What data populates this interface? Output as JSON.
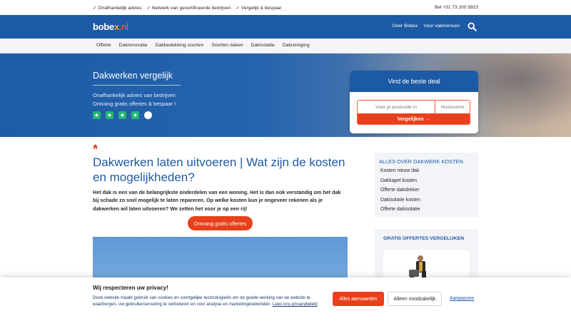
{
  "topbar": {
    "usps": [
      "Onafhankelijk advies",
      "Netwerk van gecertificeerde bedrijven",
      "Vergelijk & bespaar"
    ],
    "phone": "Bel +31 73 200 5923"
  },
  "header": {
    "logo_main": "bobe",
    "logo_x": "x",
    "logo_nl": ".nl",
    "nav": [
      "Over Bobex",
      "Voor vakmensen"
    ]
  },
  "subnav": [
    "Offerte",
    "Dakrenovatie",
    "Dakbedekking soorten",
    "Soorten daken",
    "Dakisolatie",
    "Dakreiniging"
  ],
  "hero": {
    "title": "Dakwerken vergelijk",
    "line1": "Onafhankelijk advies van bedrijven",
    "line2": "Ontvang gratis offertes & bespaar !",
    "rating": {
      "filled": 4,
      "total": 5
    },
    "deal_title": "Vind de beste deal",
    "postcode_placeholder": "Voer je postcode in",
    "housenr_placeholder": "Huisnumm",
    "compare_label": "Vergelijken →"
  },
  "article": {
    "title": "Dakwerken laten uitvoeren | Wat zijn de kosten en mogelijkheden?",
    "intro": "Het dak is een van de belangrijkste onderdelen van een woning. Het is dan ook verstandig om het dak bij schade zo snel mogelijk te laten repareren. Op welke kosten kun je ongeveer rekenen als je dakwerken wil laten uitvoeren? We zetten het voor je op een rij!",
    "cta": "Ontvang gratis offertes"
  },
  "sidebar": {
    "title": "ALLES OVER DAKWERK KOSTEN",
    "links": [
      "Kosten nieuw dak",
      "Dakkapel kosten",
      "Offerte dakdekker",
      "Dakisolatie kosten",
      "Offerte dakisolatie"
    ],
    "card_title": "GRATIS OFFERTES VERGELIJKEN"
  },
  "cookie": {
    "title": "Wij respecteren uw privacy!",
    "text": "Deze website maakt gebruik van cookies en soortgelijke technologieën om de goede werking van de website te waarborgen, uw gebruikerservaring te verbeteren en voor analyse en marketingdoeleinden.",
    "link": "Lees ons privacybeleid",
    "accept": "Alles aanvaarden",
    "necessary": "Alleen noodzakelijk",
    "customize": "Aanpassen"
  },
  "colors": {
    "brand_blue": "#1d5aa5",
    "accent_orange": "#e8401c",
    "star_green": "#22b573"
  },
  "icons": [
    "check-icon",
    "search-icon",
    "star-icon",
    "home-icon",
    "arrow-right-icon"
  ]
}
